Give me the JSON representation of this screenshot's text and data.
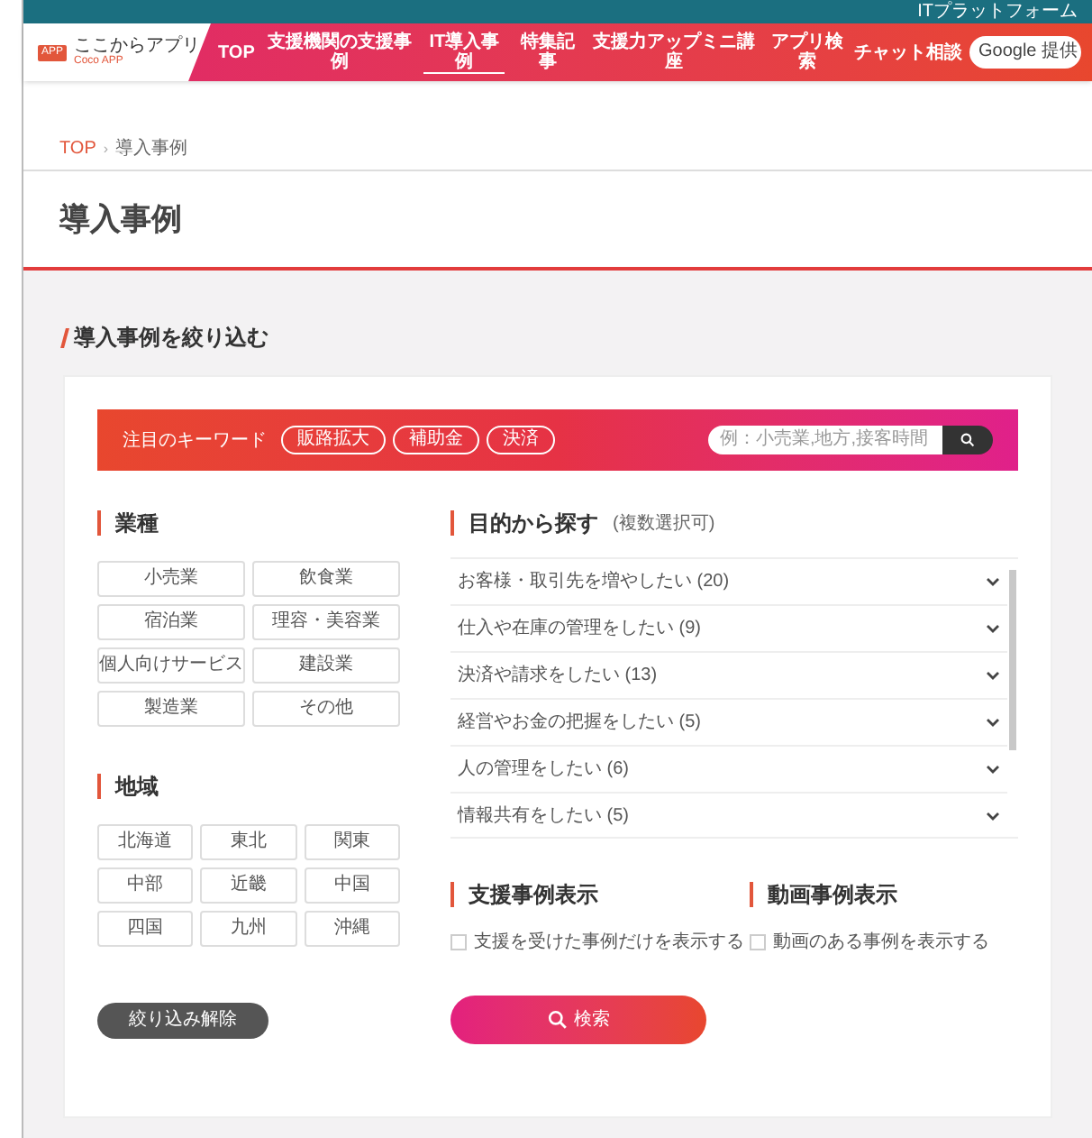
{
  "top_strip": {
    "label": "ITプラットフォーム"
  },
  "header": {
    "logo_badge": "APP",
    "logo_title": "ここからアプリ",
    "logo_subtitle": "Coco APP",
    "nav": [
      {
        "label": "TOP",
        "selected": false
      },
      {
        "label": "支援機関の支援事例",
        "selected": false
      },
      {
        "label": "IT導入事例",
        "selected": true
      },
      {
        "label": "特集記事",
        "selected": false
      },
      {
        "label": "支援力アップミニ講座",
        "selected": false
      },
      {
        "label": "アプリ検索",
        "selected": false
      }
    ],
    "chat_link": "チャット相談",
    "search_placeholder": "Google 提供"
  },
  "breadcrumb": [
    "TOP",
    "›",
    "導入事例"
  ],
  "page_title": "導入事例",
  "filter_heading": "導入事例を絞り込む",
  "keyword_bar": {
    "label": "注目のキーワード",
    "keywords": [
      "販路拡大",
      "補助金",
      "決済"
    ],
    "search_placeholder": "例：小売業,地方,接客時間"
  },
  "industry": {
    "title": "業種",
    "options": [
      {
        "label": "小売業",
        "selected": false
      },
      {
        "label": "飲食業",
        "selected": false
      },
      {
        "label": "宿泊業",
        "selected": false
      },
      {
        "label": "理容・美容業",
        "selected": false
      },
      {
        "label": "個人向けサービス",
        "selected": false
      },
      {
        "label": "建設業",
        "selected": false
      },
      {
        "label": "製造業",
        "selected": false
      },
      {
        "label": "その他",
        "selected": false
      }
    ]
  },
  "region": {
    "title": "地域",
    "options": [
      {
        "label": "北海道",
        "selected": false
      },
      {
        "label": "東北",
        "selected": false
      },
      {
        "label": "関東",
        "selected": false
      },
      {
        "label": "中部",
        "selected": false
      },
      {
        "label": "近畿",
        "selected": false
      },
      {
        "label": "中国",
        "selected": false
      },
      {
        "label": "四国",
        "selected": false
      },
      {
        "label": "九州",
        "selected": false
      },
      {
        "label": "沖縄",
        "selected": false
      }
    ]
  },
  "purpose": {
    "title": "目的から探す",
    "note": "(複数選択可)",
    "items": [
      {
        "label": "お客様・取引先を増やしたい (20)",
        "expanded": false
      },
      {
        "label": "仕入や在庫の管理をしたい (9)",
        "expanded": false
      },
      {
        "label": "決済や請求をしたい (13)",
        "expanded": false
      },
      {
        "label": "経営やお金の把握をしたい (5)",
        "expanded": false
      },
      {
        "label": "人の管理をしたい (6)",
        "expanded": false
      },
      {
        "label": "情報共有をしたい (5)",
        "expanded": false
      }
    ]
  },
  "support_cases": {
    "title": "支援事例表示",
    "option": "支援を受けた事例だけを表示する",
    "checked": false
  },
  "video_cases": {
    "title": "動画事例表示",
    "option": "動画のある事例を表示する",
    "checked": false
  },
  "clear_button": "絞り込み解除",
  "search_button": "検索"
}
